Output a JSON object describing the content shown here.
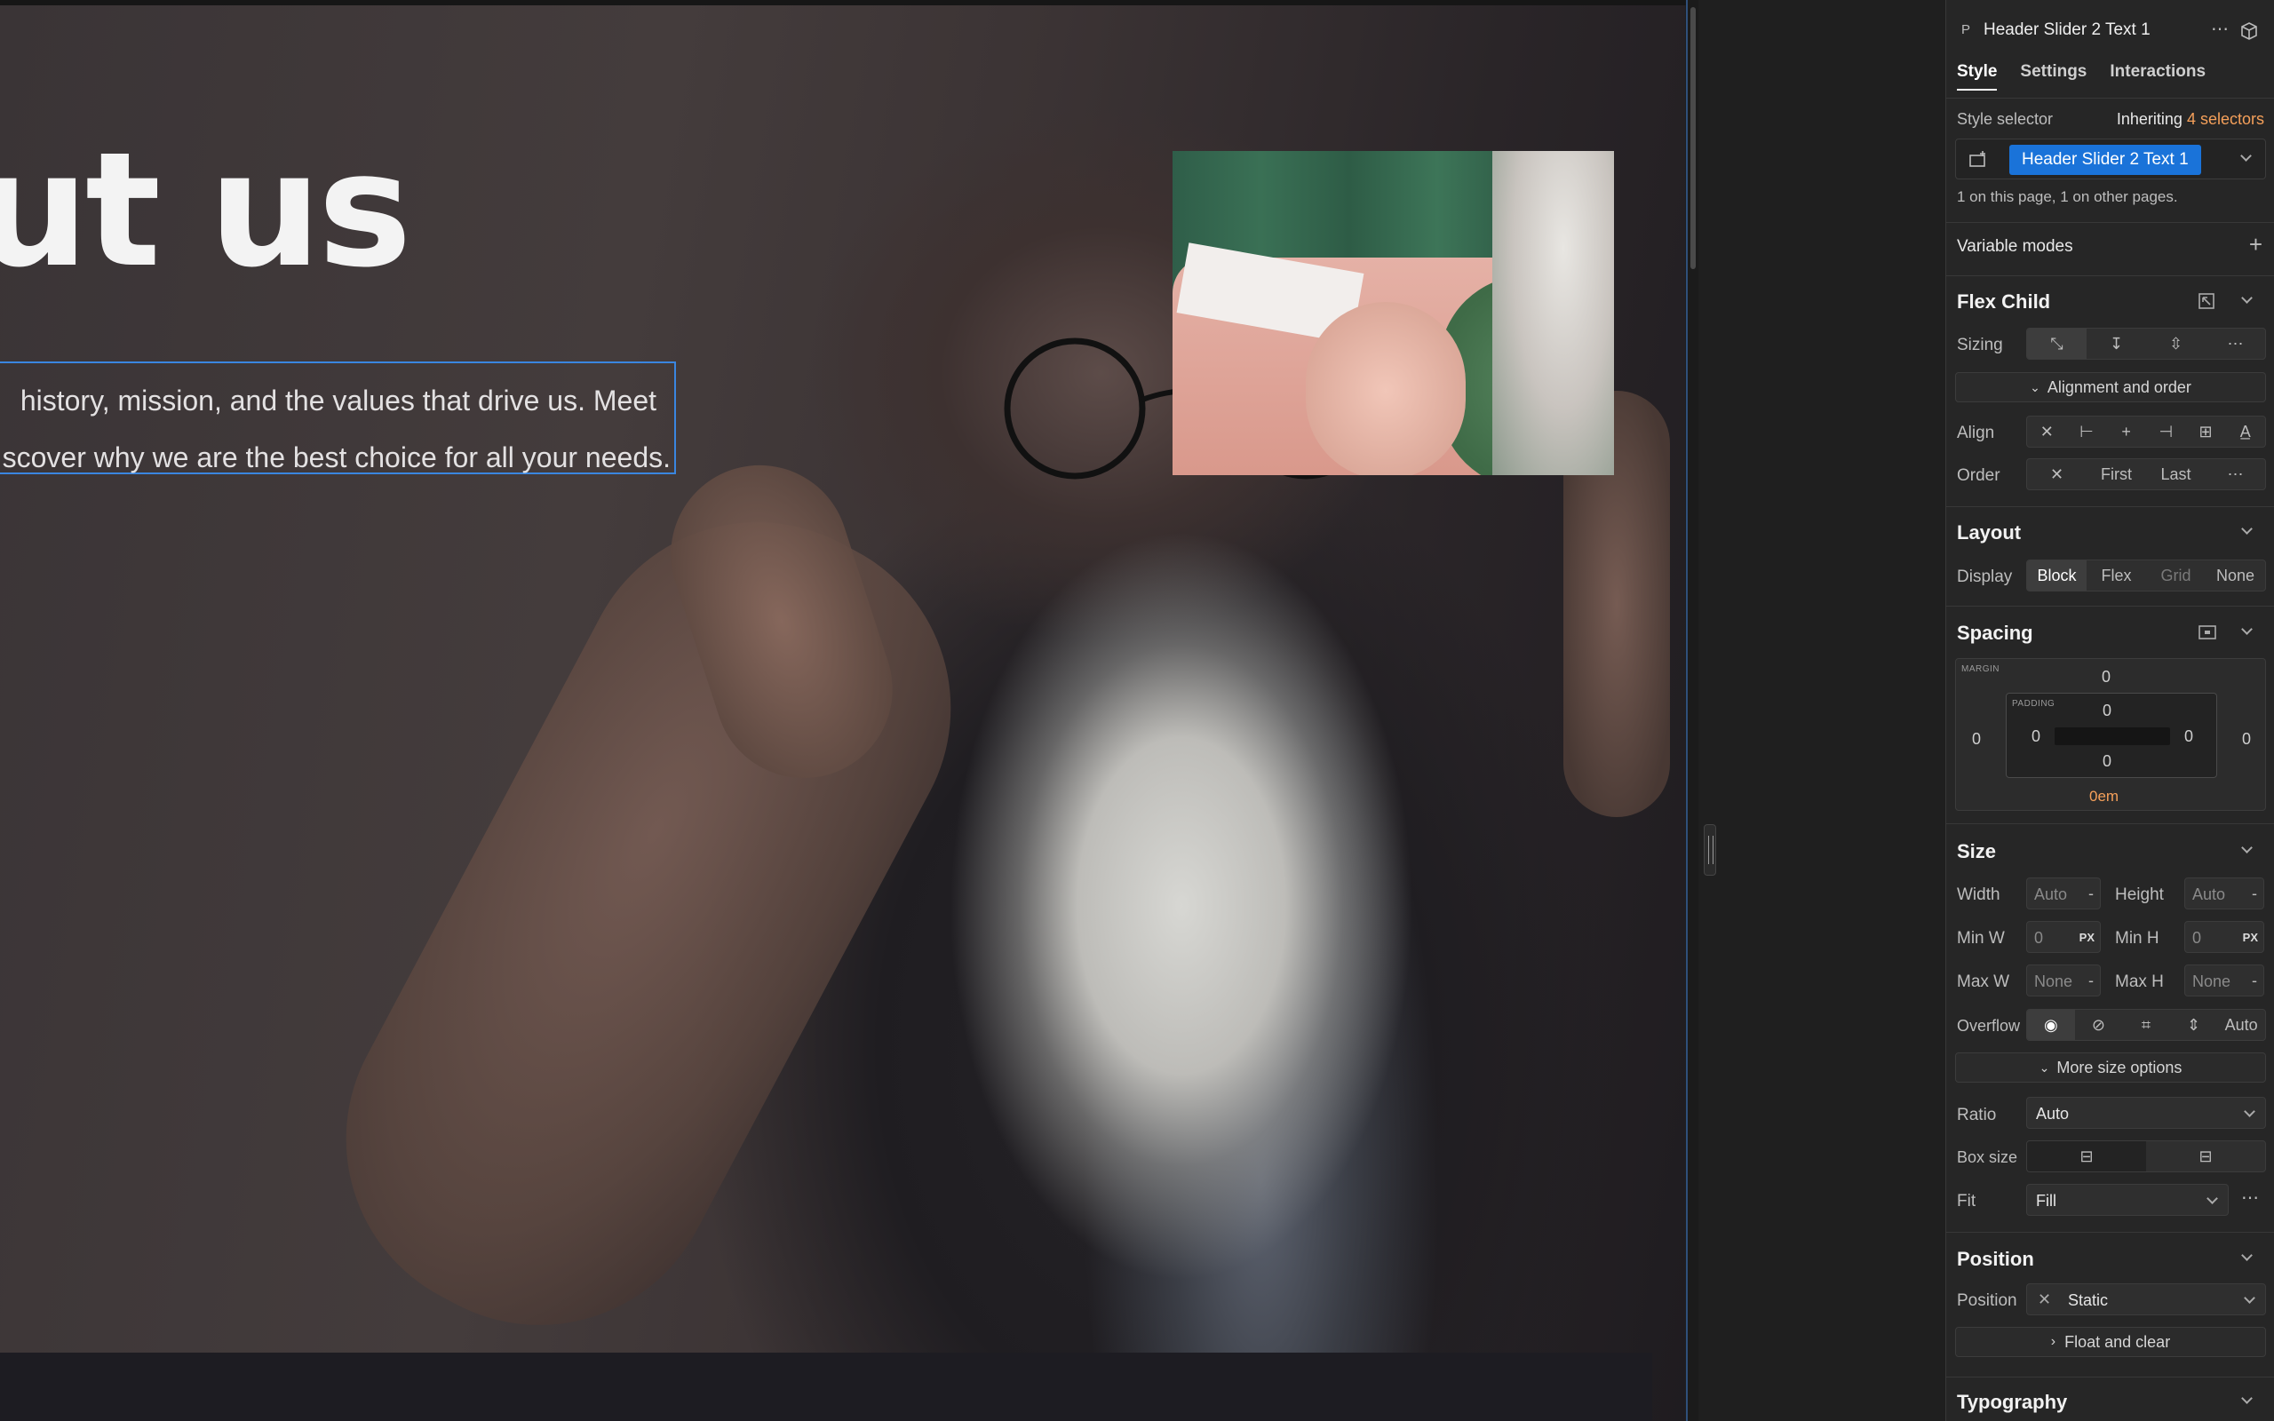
{
  "canvas": {
    "title": "out us",
    "subtitle_line1": "history, mission, and the values that drive us. Meet",
    "subtitle_line2": "scover why we are the best choice for all your needs."
  },
  "panel": {
    "element_type_icon": "P",
    "element_name": "Header Slider 2 Text 1",
    "tabs": [
      "Style",
      "Settings",
      "Interactions"
    ],
    "active_tab": "Style",
    "style_selector": {
      "label": "Style selector",
      "inheriting_label": "Inheriting",
      "inheriting_count": "4 selectors",
      "class_name": "Header Slider 2 Text 1",
      "usage": "1 on this page, 1 on other pages."
    },
    "variable_modes": {
      "label": "Variable modes"
    },
    "flex_child": {
      "title": "Flex Child",
      "sizing_label": "Sizing",
      "alignment_toggle": "Alignment and order",
      "align_label": "Align",
      "order_label": "Order",
      "order_options": [
        "First",
        "Last"
      ]
    },
    "layout": {
      "title": "Layout",
      "display_label": "Display",
      "display_options": [
        "Block",
        "Flex",
        "Grid",
        "None"
      ],
      "display_selected": "Block"
    },
    "spacing": {
      "title": "Spacing",
      "margin_label": "MARGIN",
      "padding_label": "PADDING",
      "margin_top": "0",
      "margin_left": "0",
      "margin_right": "0",
      "padding_top": "0",
      "padding_left": "0",
      "padding_right": "0",
      "padding_bottom": "0",
      "margin_bottom": "0em"
    },
    "size": {
      "title": "Size",
      "width_label": "Width",
      "width_value": "Auto",
      "height_label": "Height",
      "height_value": "Auto",
      "minw_label": "Min W",
      "minw_value": "0",
      "minw_unit": "PX",
      "minh_label": "Min H",
      "minh_value": "0",
      "minh_unit": "PX",
      "maxw_label": "Max W",
      "maxw_value": "None",
      "maxh_label": "Max H",
      "maxh_value": "None",
      "overflow_label": "Overflow",
      "overflow_auto": "Auto",
      "more_options": "More size options",
      "ratio_label": "Ratio",
      "ratio_value": "Auto",
      "boxsize_label": "Box size",
      "fit_label": "Fit",
      "fit_value": "Fill",
      "unit_dash": "-"
    },
    "position": {
      "title": "Position",
      "position_label": "Position",
      "position_value": "Static",
      "float_toggle": "Float and clear"
    },
    "typography": {
      "title": "Typography"
    }
  },
  "colors": {
    "accent": "#1a73d9",
    "warning": "#f5a05a"
  }
}
